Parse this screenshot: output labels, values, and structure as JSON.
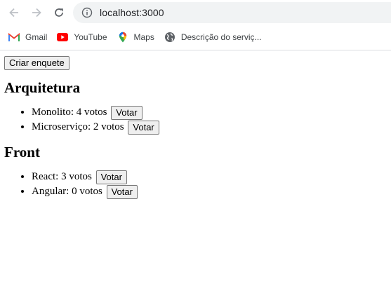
{
  "browser": {
    "url": "localhost:3000",
    "bookmarks": [
      {
        "label": "Gmail",
        "icon": "gmail-icon"
      },
      {
        "label": "YouTube",
        "icon": "youtube-icon"
      },
      {
        "label": "Maps",
        "icon": "maps-icon"
      },
      {
        "label": "Descrição do serviç...",
        "icon": "globe-icon"
      }
    ]
  },
  "app": {
    "create_poll_label": "Criar enquete",
    "polls": [
      {
        "title": "Arquitetura",
        "options": [
          {
            "text": "Monolito: 4 votos",
            "vote_label": "Votar"
          },
          {
            "text": "Microserviço: 2 votos",
            "vote_label": "Votar"
          }
        ]
      },
      {
        "title": "Front",
        "options": [
          {
            "text": "React: 3 votos",
            "vote_label": "Votar"
          },
          {
            "text": "Angular: 0 votos",
            "vote_label": "Votar"
          }
        ]
      }
    ]
  },
  "colors": {
    "chrome_border": "#dadce0",
    "omnibox_bg": "#f1f3f4",
    "button_bg": "#efefef",
    "button_border": "#767676"
  }
}
